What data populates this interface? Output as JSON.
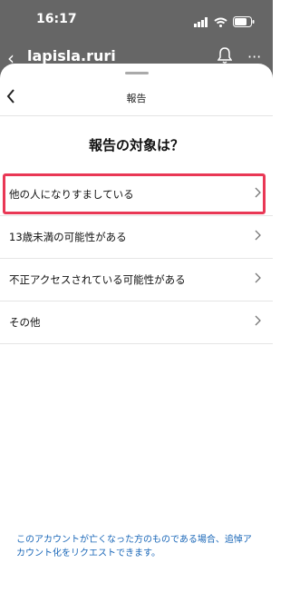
{
  "status_bar": {
    "time": "16:17"
  },
  "topbar": {
    "username": "lapisla.ruri"
  },
  "sheet": {
    "title": "報告",
    "question": "報告の対象は？",
    "options": [
      {
        "label": "他の人になりすましている"
      },
      {
        "label": "13歳未満の可能性がある"
      },
      {
        "label": "不正アクセスされている可能性がある"
      },
      {
        "label": "その他"
      }
    ],
    "footer_text": "このアカウントが亡くなった方のものである場合、追悼アカウント化をリクエストできます。"
  }
}
